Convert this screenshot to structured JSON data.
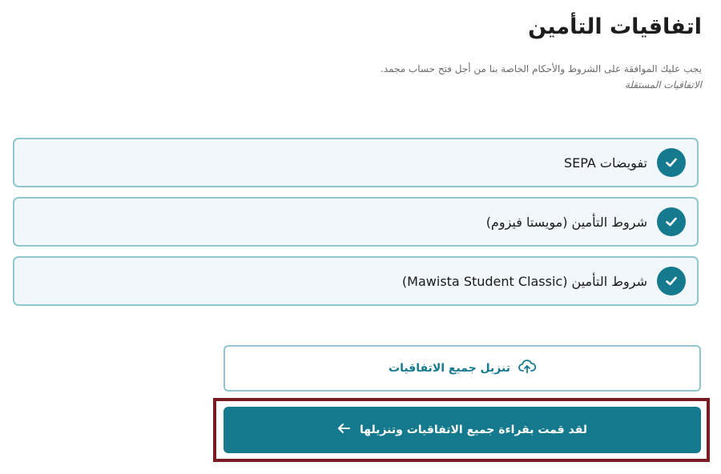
{
  "header": {
    "title": "اتفاقيات التأمين",
    "subtitle_line1": "يجب عليك الموافقة على الشروط والأحكام الخاصة بنا من أجل فتح حساب مجمد.",
    "subtitle_line2": "الاتفاقيات المستقلة"
  },
  "agreements": [
    {
      "label": "تفويضات SEPA",
      "icon": "check-icon"
    },
    {
      "label": "شروط التأمين (مويستا فيزوم)",
      "icon": "check-icon"
    },
    {
      "label": "شروط التأمين (Mawista Student Classic)",
      "icon": "check-icon"
    }
  ],
  "download_button": {
    "label": "تنزيل جميع الاتفاقيات",
    "icon": "upload-cloud-icon"
  },
  "confirm_button": {
    "label": "لقد قمت بقراءة جميع الاتفاقيات وتنزيلها",
    "icon": "arrow-left-icon"
  },
  "colors": {
    "accent": "#167a8e",
    "card_border": "#8fc6cf",
    "card_bg": "#f1f7fa",
    "highlight": "#7a1c24"
  }
}
